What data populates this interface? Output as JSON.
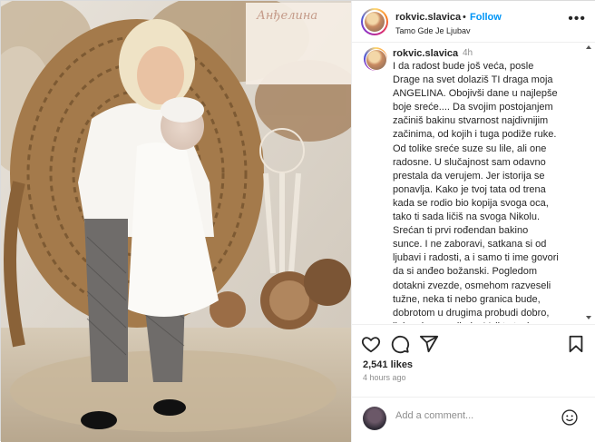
{
  "post": {
    "username": "rokvic.slavica",
    "separator": "•",
    "follow_label": "Follow",
    "location": "Tamo Gde Je Ljubav",
    "more_label": "•••"
  },
  "photo": {
    "sign_text": "Анђелина"
  },
  "caption": {
    "username": "rokvic.slavica",
    "time": "4h",
    "text": "I da radost bude još veća, posle\nDrage na svet dolaziš TI draga moja\nANGELINA. Obojivši dane u najlepše\nboje sreće.... Da svojim postojanjem\nzačiniš bakinu stvarnost najdivnijim\nzačinima, od kojih i tuga podiže ruke.\nOd tolike sreće suze su lile, ali one\nradosne. U slučajnost sam odavno\nprestala da verujem. Jer istorija se\nponavlja. Kako je tvoj tata od trena\nkada se rodio bio kopija svoga oca,\ntako ti sada ličiš na svoga Nikolu.\nSrećan ti prvi rođendan bakino\nsunce. I ne zaboravi, satkana si od\nljubavi i radosti, a i samo ti ime govori\nda si anđeo božanski. Pogledom\ndotakni zvezde, osmehom razveseli\ntužne, neka ti nebo granica bude,\ndobrotom u drugima probudi dobro,\nljubav i veru u ljude. Voli te tvoja"
  },
  "actions": {
    "like_icon": "heart-icon",
    "comment_icon": "comment-icon",
    "share_icon": "share-icon",
    "save_icon": "bookmark-icon",
    "likes": "2,541 likes",
    "time_ago": "4 hours ago"
  },
  "comment": {
    "placeholder": "Add a comment..."
  },
  "colors": {
    "accent": "#0095f6",
    "text": "#262626",
    "muted": "#8e8e8e",
    "border": "#dbdbdb"
  }
}
